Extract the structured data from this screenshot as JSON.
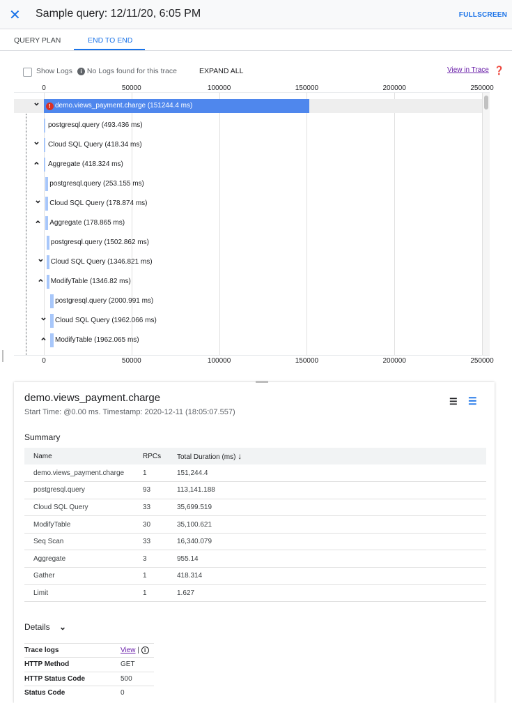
{
  "header": {
    "title": "Sample query: 12/11/20, 6:05 PM",
    "fullscreen": "FULLSCREEN",
    "close_icon": "close-icon"
  },
  "tabs": [
    {
      "label": "QUERY PLAN"
    },
    {
      "label": "END TO END",
      "active": true
    }
  ],
  "toolbar": {
    "show_logs": "Show Logs",
    "show_logs_checked": false,
    "no_logs": "No Logs found for this trace",
    "expand_all": "EXPAND ALL",
    "view_in_trace": "View in Trace"
  },
  "colors": {
    "accent": "#1a73e8",
    "root_bar": "#4f87ed",
    "child_bar": "#a8c7fa",
    "error": "#d93025"
  },
  "chart_data": {
    "type": "bar",
    "orientation": "horizontal-timeline",
    "xlim": [
      0,
      250000
    ],
    "ticks": [
      "0",
      "50000",
      "100000",
      "150000",
      "200000",
      "250000"
    ],
    "spans": [
      {
        "label": "demo.views_payment.charge (151244.4 ms)",
        "start": 0,
        "duration": 151244.4,
        "chevron": "down",
        "error": true,
        "indent": 0
      },
      {
        "label": "postgresql.query (493.436 ms)",
        "start": 0,
        "duration": 493.436,
        "chevron": "",
        "indent": 0
      },
      {
        "label": "Cloud SQL Query (418.34 ms)",
        "start": 0,
        "duration": 418.34,
        "chevron": "down",
        "indent": 0
      },
      {
        "label": "Aggregate (418.324 ms)",
        "start": 0,
        "duration": 418.324,
        "chevron": "up",
        "indent": 0
      },
      {
        "label": "postgresql.query (253.155 ms)",
        "start": 900,
        "duration": 253.155,
        "chevron": "",
        "indent": 1
      },
      {
        "label": "Cloud SQL Query (178.874 ms)",
        "start": 900,
        "duration": 178.874,
        "chevron": "down",
        "indent": 1
      },
      {
        "label": "Aggregate (178.865 ms)",
        "start": 900,
        "duration": 178.865,
        "chevron": "up",
        "indent": 1
      },
      {
        "label": "postgresql.query (1502.862 ms)",
        "start": 1500,
        "duration": 1502.862,
        "chevron": "",
        "indent": 2
      },
      {
        "label": "Cloud SQL Query (1346.821 ms)",
        "start": 1500,
        "duration": 1346.821,
        "chevron": "down",
        "indent": 2
      },
      {
        "label": "ModifyTable (1346.82 ms)",
        "start": 1500,
        "duration": 1346.82,
        "chevron": "up",
        "indent": 2
      },
      {
        "label": "postgresql.query (2000.991 ms)",
        "start": 3600,
        "duration": 2000.991,
        "chevron": "",
        "indent": 3
      },
      {
        "label": "Cloud SQL Query (1962.066 ms)",
        "start": 3600,
        "duration": 1962.066,
        "chevron": "down",
        "indent": 3
      },
      {
        "label": "ModifyTable (1962.065 ms)",
        "start": 3600,
        "duration": 1962.065,
        "chevron": "up",
        "indent": 3
      }
    ]
  },
  "detail": {
    "span_name": "demo.views_payment.charge",
    "start_info": "Start Time: @0.00 ms. Timestamp: 2020-12-11 (18:05:07.557)",
    "summary_title": "Summary",
    "columns": [
      "Name",
      "RPCs",
      "Total Duration (ms)"
    ],
    "rows": [
      [
        "demo.views_payment.charge",
        "1",
        "151,244.4"
      ],
      [
        "postgresql.query",
        "93",
        "113,141.188"
      ],
      [
        "Cloud SQL Query",
        "33",
        "35,699.519"
      ],
      [
        "ModifyTable",
        "30",
        "35,100.621"
      ],
      [
        "Seq Scan",
        "33",
        "16,340.079"
      ],
      [
        "Aggregate",
        "3",
        "955.14"
      ],
      [
        "Gather",
        "1",
        "418.314"
      ],
      [
        "Limit",
        "1",
        "1.627"
      ]
    ],
    "details_title": "Details",
    "details": [
      [
        "Trace logs",
        "View"
      ],
      [
        "HTTP Method",
        "GET"
      ],
      [
        "HTTP Status Code",
        "500"
      ],
      [
        "Status Code",
        "0"
      ]
    ]
  }
}
